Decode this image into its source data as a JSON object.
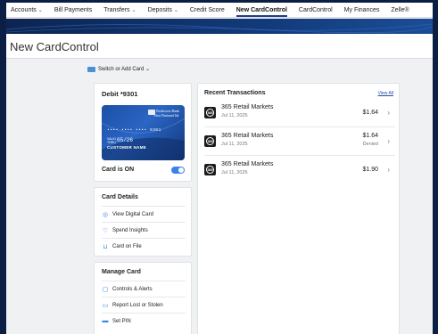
{
  "nav": {
    "items": [
      {
        "label": "Accounts",
        "dropdown": true
      },
      {
        "label": "Bill Payments",
        "dropdown": false
      },
      {
        "label": "Transfers",
        "dropdown": true
      },
      {
        "label": "Deposits",
        "dropdown": true
      },
      {
        "label": "Credit Score",
        "dropdown": false
      },
      {
        "label": "New CardControl",
        "dropdown": false,
        "active": true
      },
      {
        "label": "CardControl",
        "dropdown": false
      },
      {
        "label": "My Finances",
        "dropdown": false
      },
      {
        "label": "Zelle®",
        "dropdown": false
      }
    ],
    "caret": "⌄"
  },
  "page": {
    "title": "New CardControl"
  },
  "switch_card": {
    "label": "Switch or Add Card ⌄",
    "icon": "credit-card-icon"
  },
  "debit": {
    "title": "Debit *9301",
    "card": {
      "bank_line1": "Northwest Bank",
      "bank_line2": "First National ltd.",
      "number": "•••• •••• •••• 9301",
      "valid_label_1": "VALID",
      "valid_label_2": "THRU",
      "expiry": "05/26",
      "holder": "CUSTOMER NAME"
    },
    "status": "Card is ON",
    "toggle_on": true
  },
  "card_details": {
    "heading": "Card Details",
    "items": [
      {
        "label": "View Digital Card",
        "icon": "eye-icon"
      },
      {
        "label": "Spend Insights",
        "icon": "lightbulb-icon"
      },
      {
        "label": "Card on File",
        "icon": "cart-icon"
      }
    ]
  },
  "manage_card": {
    "heading": "Manage Card",
    "items": [
      {
        "label": "Controls & Alerts",
        "icon": "clipboard-icon"
      },
      {
        "label": "Report Lost or Stolen",
        "icon": "card-alert-icon"
      },
      {
        "label": "Set PIN",
        "icon": "pin-card-icon"
      }
    ]
  },
  "transactions": {
    "heading": "Recent Transactions",
    "view_all": "View All",
    "logo_text": "365",
    "rows": [
      {
        "merchant": "365 Retail Markets",
        "date": "Jul 11, 2025",
        "amount": "$1.64",
        "status": ""
      },
      {
        "merchant": "365 Retail Markets",
        "date": "Jul 11, 2025",
        "amount": "$1.64",
        "status": "Denied"
      },
      {
        "merchant": "365 Retail Markets",
        "date": "Jul 11, 2025",
        "amount": "$1.90",
        "status": ""
      }
    ],
    "chevron": "›"
  },
  "colors": {
    "accent": "#3b82e8",
    "navy": "#0b1f44",
    "link": "#1d4fa8"
  }
}
